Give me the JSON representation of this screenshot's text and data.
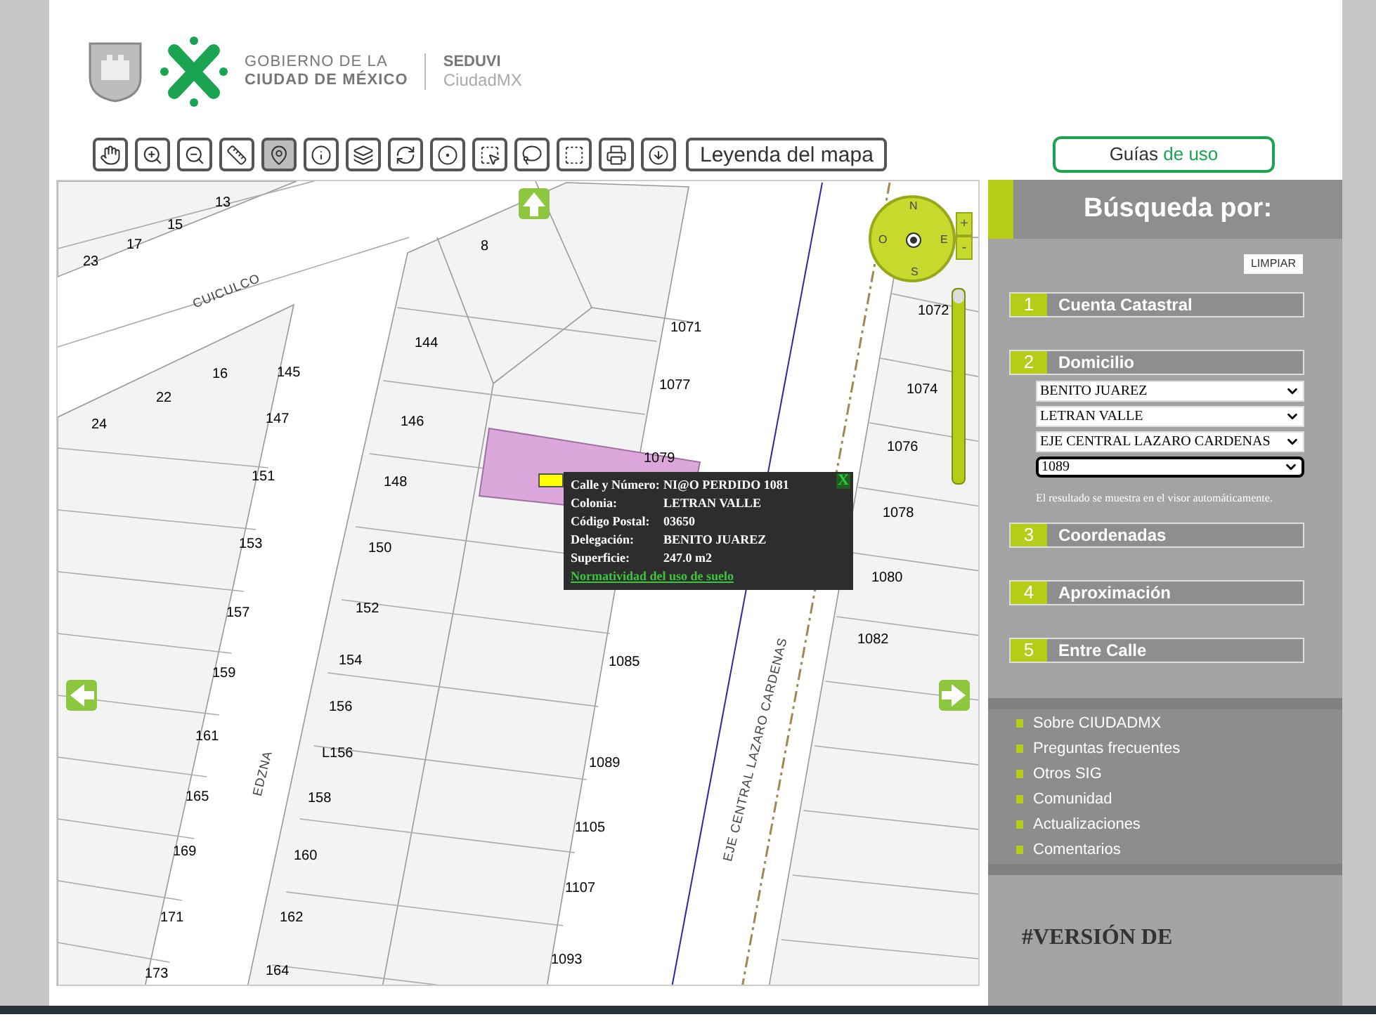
{
  "header": {
    "org_lines": [
      "GOBIERNO DE LA",
      "CIUDAD DE MÉXICO"
    ],
    "agency": "SEDUVI",
    "product": "CiudadMX"
  },
  "toolbar": {
    "tools": [
      {
        "kind": "pan",
        "selected": false
      },
      {
        "kind": "zoom-in",
        "selected": false
      },
      {
        "kind": "zoom-out",
        "selected": false
      },
      {
        "kind": "measure",
        "selected": false
      },
      {
        "kind": "pin",
        "selected": true
      },
      {
        "kind": "info",
        "selected": false
      },
      {
        "kind": "layers",
        "selected": false
      },
      {
        "kind": "refresh",
        "selected": false
      },
      {
        "kind": "circle",
        "selected": false
      },
      {
        "kind": "rect-select",
        "selected": false
      },
      {
        "kind": "lasso",
        "selected": false
      },
      {
        "kind": "polygon",
        "selected": false
      },
      {
        "kind": "print",
        "selected": false
      },
      {
        "kind": "download",
        "selected": false
      }
    ],
    "legend_button": "Leyenda del mapa"
  },
  "guides_button": {
    "text": "Guías",
    "accent": "de uso"
  },
  "map": {
    "streets": [
      "CUICULCO",
      "EDZNA",
      "EJE CENTRAL LAZARO CARDENAS"
    ],
    "parcel_labels": [
      "13",
      "15",
      "17",
      "23",
      "8",
      "1071",
      "144",
      "1077",
      "1072",
      "16",
      "145",
      "22",
      "147",
      "24",
      "146",
      "1074",
      "1079",
      "1076",
      "151",
      "148",
      "1078",
      "153",
      "150",
      "1080",
      "157",
      "152",
      "1082",
      "1085",
      "159",
      "154",
      "156",
      "161",
      "L156",
      "1089",
      "165",
      "158",
      "1105",
      "169",
      "160",
      "1107",
      "171",
      "162",
      "1093",
      "173",
      "164"
    ],
    "popup": {
      "fields": [
        {
          "label": "Calle y Número:",
          "value": "NI@O PERDIDO 1081"
        },
        {
          "label": "Colonia:",
          "value": "LETRAN VALLE"
        },
        {
          "label": "Código Postal:",
          "value": "03650"
        },
        {
          "label": "Delegación:",
          "value": "BENITO JUAREZ"
        },
        {
          "label": "Superficie:",
          "value": "247.0 m2"
        }
      ],
      "link": "Normatividad del uso de suelo",
      "close": "X"
    },
    "compass": [
      "N",
      "O",
      "E",
      "S"
    ],
    "zoom_buttons": [
      "+",
      "-"
    ],
    "zoom_slider": {
      "level": 1
    }
  },
  "search_panel": {
    "title": "Búsqueda por:",
    "clear_button": "LIMPIAR",
    "sections": [
      {
        "number": "1",
        "label": "Cuenta Catastral"
      },
      {
        "number": "2",
        "label": "Domicilio",
        "selects": [
          {
            "value": "BENITO JUAREZ",
            "focused": false
          },
          {
            "value": "LETRAN VALLE",
            "focused": false
          },
          {
            "value": "EJE CENTRAL LAZARO CARDENAS",
            "focused": false
          },
          {
            "value": "1089",
            "focused": true
          }
        ],
        "hint": "El resultado se muestra en el visor automáticamente."
      },
      {
        "number": "3",
        "label": "Coordenadas"
      },
      {
        "number": "4",
        "label": "Aproximación"
      },
      {
        "number": "5",
        "label": "Entre Calle"
      }
    ],
    "links": [
      "Sobre CIUDADMX",
      "Preguntas frecuentes",
      "Otros SIG",
      "Comunidad",
      "Actualizaciones",
      "Comentarios"
    ],
    "footer_heading": "#VERSIÓN DE"
  }
}
